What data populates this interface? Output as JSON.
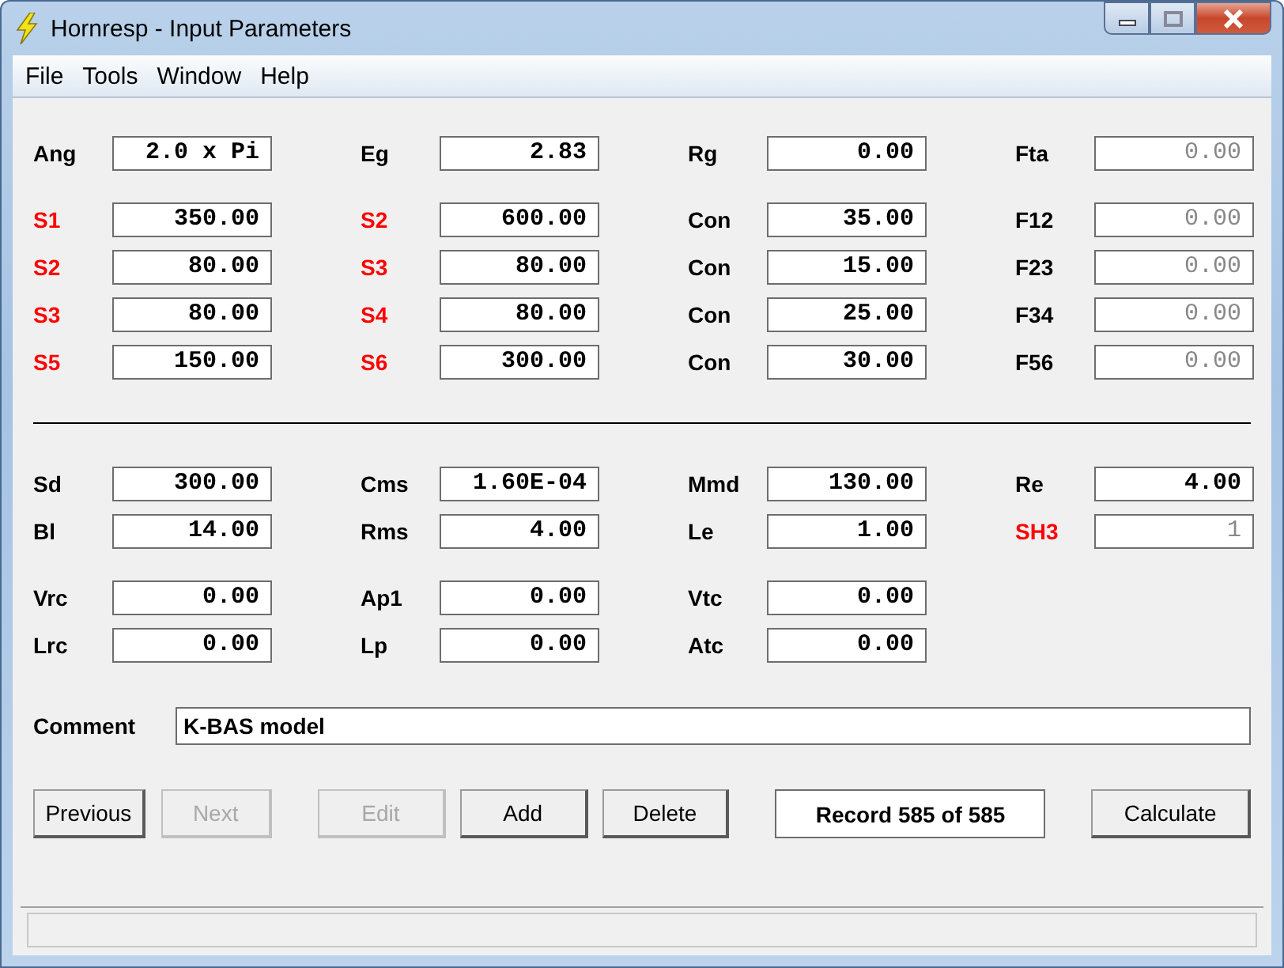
{
  "window": {
    "title": "Hornresp - Input Parameters"
  },
  "menu": [
    {
      "label": "File"
    },
    {
      "label": "Tools"
    },
    {
      "label": "Window"
    },
    {
      "label": "Help"
    }
  ],
  "panels": [
    {
      "groups": [
        [
          [
            {
              "label": "Ang",
              "value": "2.0 x Pi",
              "color": "#000000",
              "disabled": false
            },
            {
              "label": "Eg",
              "value": "2.83",
              "color": "#000000",
              "disabled": false
            },
            {
              "label": "Rg",
              "value": "0.00",
              "color": "#000000",
              "disabled": false
            },
            {
              "label": "Fta",
              "value": "0.00",
              "color": "#000000",
              "disabled": true
            }
          ]
        ],
        [
          [
            {
              "label": "S1",
              "value": "350.00",
              "color": "#ff0000",
              "disabled": false
            },
            {
              "label": "S2",
              "value": "600.00",
              "color": "#ff0000",
              "disabled": false
            },
            {
              "label": "Con",
              "value": "35.00",
              "color": "#000000",
              "disabled": false
            },
            {
              "label": "F12",
              "value": "0.00",
              "color": "#000000",
              "disabled": true
            }
          ],
          [
            {
              "label": "S2",
              "value": "80.00",
              "color": "#ff0000",
              "disabled": false
            },
            {
              "label": "S3",
              "value": "80.00",
              "color": "#ff0000",
              "disabled": false
            },
            {
              "label": "Con",
              "value": "15.00",
              "color": "#000000",
              "disabled": false
            },
            {
              "label": "F23",
              "value": "0.00",
              "color": "#000000",
              "disabled": true
            }
          ],
          [
            {
              "label": "S3",
              "value": "80.00",
              "color": "#ff0000",
              "disabled": false
            },
            {
              "label": "S4",
              "value": "80.00",
              "color": "#ff0000",
              "disabled": false
            },
            {
              "label": "Con",
              "value": "25.00",
              "color": "#000000",
              "disabled": false
            },
            {
              "label": "F34",
              "value": "0.00",
              "color": "#000000",
              "disabled": true
            }
          ],
          [
            {
              "label": "S5",
              "value": "150.00",
              "color": "#ff0000",
              "disabled": false
            },
            {
              "label": "S6",
              "value": "300.00",
              "color": "#ff0000",
              "disabled": false
            },
            {
              "label": "Con",
              "value": "30.00",
              "color": "#000000",
              "disabled": false
            },
            {
              "label": "F56",
              "value": "0.00",
              "color": "#000000",
              "disabled": true
            }
          ]
        ]
      ]
    },
    {
      "groups": [
        [
          [
            {
              "label": "Sd",
              "value": "300.00",
              "color": "#000000",
              "disabled": false
            },
            {
              "label": "Cms",
              "value": "1.60E-04",
              "color": "#000000",
              "disabled": false
            },
            {
              "label": "Mmd",
              "value": "130.00",
              "color": "#000000",
              "disabled": false
            },
            {
              "label": "Re",
              "value": "4.00",
              "color": "#000000",
              "disabled": false
            }
          ],
          [
            {
              "label": "Bl",
              "value": "14.00",
              "color": "#000000",
              "disabled": false
            },
            {
              "label": "Rms",
              "value": "4.00",
              "color": "#000000",
              "disabled": false
            },
            {
              "label": "Le",
              "value": "1.00",
              "color": "#000000",
              "disabled": false
            },
            {
              "label": "SH3",
              "value": "1",
              "color": "#ff0000",
              "disabled": true
            }
          ]
        ],
        [
          [
            {
              "label": "Vrc",
              "value": "0.00",
              "color": "#000000",
              "disabled": false
            },
            {
              "label": "Ap1",
              "value": "0.00",
              "color": "#000000",
              "disabled": false
            },
            {
              "label": "Vtc",
              "value": "0.00",
              "color": "#000000",
              "disabled": false
            }
          ],
          [
            {
              "label": "Lrc",
              "value": "0.00",
              "color": "#000000",
              "disabled": false
            },
            {
              "label": "Lp",
              "value": "0.00",
              "color": "#000000",
              "disabled": false
            },
            {
              "label": "Atc",
              "value": "0.00",
              "color": "#000000",
              "disabled": false
            }
          ]
        ]
      ]
    }
  ],
  "comment": {
    "label": "Comment",
    "value": "K-BAS model"
  },
  "buttons": [
    {
      "label": "Previous",
      "disabled": false
    },
    {
      "label": "Next",
      "disabled": true
    },
    {
      "label": "Edit",
      "disabled": true
    },
    {
      "label": "Add",
      "disabled": false
    },
    {
      "label": "Delete",
      "disabled": false
    }
  ],
  "record": "Record 585 of 585",
  "calculate": {
    "label": "Calculate",
    "disabled": false
  }
}
